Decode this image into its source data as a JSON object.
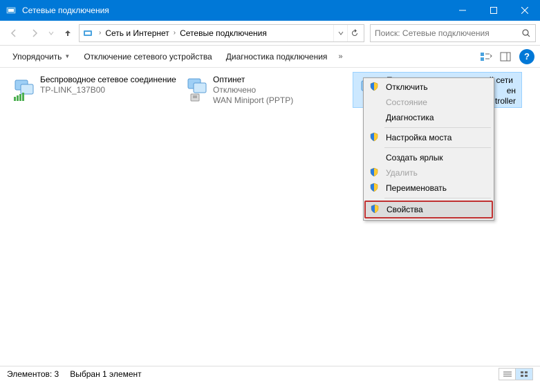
{
  "window": {
    "title": "Сетевые подключения"
  },
  "breadcrumb": {
    "items": [
      "Сеть и Интернет",
      "Сетевые подключения"
    ]
  },
  "search": {
    "placeholder": "Поиск: Сетевые подключения"
  },
  "toolbar": {
    "organize": "Упорядочить",
    "disable": "Отключение сетевого устройства",
    "diagnose": "Диагностика подключения"
  },
  "connections": [
    {
      "name": "Беспроводное сетевое соединение",
      "status": "",
      "device": "TP-LINK_137B00",
      "type": "wifi"
    },
    {
      "name": "Оптинет",
      "status": "Отключено",
      "device": "WAN Miniport (PPTP)",
      "type": "wan"
    },
    {
      "name": "Подключение по локальной сети",
      "status": "ен",
      "device": "troller",
      "type": "lan"
    }
  ],
  "context_menu": {
    "disable": "Отключить",
    "status": "Состояние",
    "diagnose": "Диагностика",
    "bridge": "Настройка моста",
    "shortcut": "Создать ярлык",
    "delete": "Удалить",
    "rename": "Переименовать",
    "properties": "Свойства"
  },
  "statusbar": {
    "count": "Элементов: 3",
    "selected": "Выбран 1 элемент"
  }
}
